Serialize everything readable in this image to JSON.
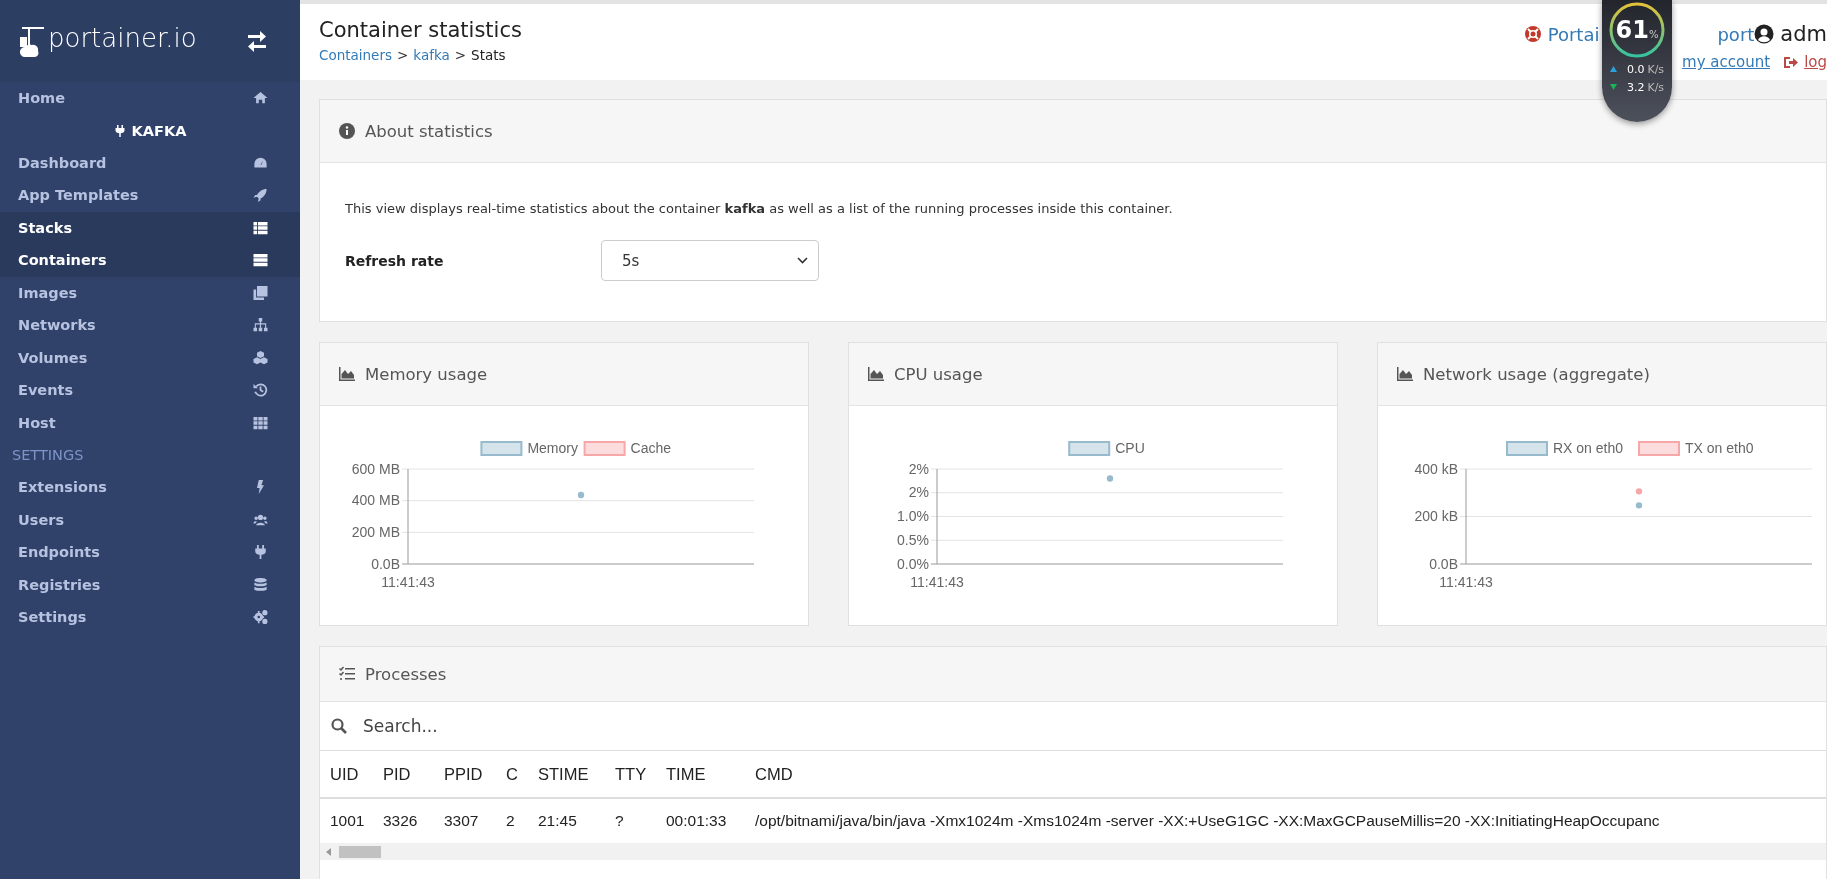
{
  "sidebar": {
    "logo": "portainer.io",
    "items": [
      {
        "kind": "link",
        "label": "Home",
        "selected": false
      },
      {
        "kind": "endpoint",
        "label": "KAFKA"
      },
      {
        "kind": "link",
        "label": "Dashboard",
        "selected": false
      },
      {
        "kind": "link",
        "label": "App Templates",
        "selected": false
      },
      {
        "kind": "link",
        "label": "Stacks",
        "selected": true
      },
      {
        "kind": "link",
        "label": "Containers",
        "selected": true
      },
      {
        "kind": "link",
        "label": "Images",
        "selected": false
      },
      {
        "kind": "link",
        "label": "Networks",
        "selected": false
      },
      {
        "kind": "link",
        "label": "Volumes",
        "selected": false
      },
      {
        "kind": "link",
        "label": "Events",
        "selected": false
      },
      {
        "kind": "link",
        "label": "Host",
        "selected": false
      },
      {
        "kind": "section",
        "label": "SETTINGS"
      },
      {
        "kind": "link",
        "label": "Extensions",
        "selected": false
      },
      {
        "kind": "link",
        "label": "Users",
        "selected": false
      },
      {
        "kind": "link",
        "label": "Endpoints",
        "selected": false
      },
      {
        "kind": "link",
        "label": "Registries",
        "selected": false
      },
      {
        "kind": "link",
        "label": "Settings",
        "selected": false
      }
    ]
  },
  "header": {
    "title": "Container statistics",
    "breadcrumb": [
      {
        "kind": "link",
        "label": "Containers"
      },
      {
        "kind": "separator",
        "label": ">"
      },
      {
        "kind": "link",
        "label": "kafka"
      },
      {
        "kind": "separator",
        "label": ">"
      },
      {
        "kind": "current",
        "label": "Stats"
      }
    ],
    "support_link": [
      "Portai",
      "port"
    ],
    "user": "adm",
    "account_link": "my account",
    "logout_link": "log"
  },
  "monitor_widget": {
    "value": "61",
    "unit": "%",
    "upload": "0.0",
    "upload_unit": "K/s",
    "download": "3.2",
    "download_unit": "K/s"
  },
  "about": {
    "title": "About statistics",
    "text": "This view displays real-time statistics about the container **kafka** as well as a list of the running processes inside this container.",
    "refresh_label": "Refresh rate",
    "refresh_value": "5s"
  },
  "charts": [
    {
      "title": "Memory usage",
      "chart_data": {
        "type": "line",
        "grid": true,
        "legend": "top",
        "annotations": [
          {
            "text": "11:41:43"
          }
        ],
        "ylim": [
          0,
          600
        ],
        "yticks": [
          {
            "value": 0,
            "label": "0.0B"
          },
          {
            "value": 200,
            "label": "200 MB"
          },
          {
            "value": 400,
            "label": "400 MB"
          },
          {
            "value": 600,
            "label": "600 MB"
          }
        ],
        "series": [
          {
            "name": "Memory",
            "color": "#97bbcd",
            "marker": "circle",
            "values": [
              436
            ]
          },
          {
            "name": "Cache",
            "color": "#f7a7a7",
            "values": [
              null
            ]
          }
        ]
      }
    },
    {
      "title": "CPU usage",
      "chart_data": {
        "type": "line",
        "grid": true,
        "legend": "top",
        "annotations": [
          {
            "text": "11:41:43"
          }
        ],
        "ylim": [
          0,
          2
        ],
        "yticks": [
          {
            "value": 0,
            "label": "0.0%"
          },
          {
            "value": 0.5,
            "label": "0.5%"
          },
          {
            "value": 1,
            "label": "1.0%"
          },
          {
            "value": 1.5,
            "label": "2%"
          },
          {
            "value": 2,
            "label": "2%"
          }
        ],
        "series": [
          {
            "name": "CPU",
            "color": "#97bbcd",
            "marker": "circle",
            "values": [
              1.8
            ]
          }
        ]
      }
    },
    {
      "title": "Network usage (aggregate)",
      "chart_data": {
        "type": "line",
        "grid": true,
        "legend": "top",
        "annotations": [
          {
            "text": "11:41:43"
          }
        ],
        "ylim": [
          0,
          400
        ],
        "yticks": [
          {
            "value": 0,
            "label": "0.0B"
          },
          {
            "value": 200,
            "label": "200 kB"
          },
          {
            "value": 400,
            "label": "400 kB"
          }
        ],
        "series": [
          {
            "name": "RX on eth0",
            "color": "#97bbcd",
            "marker": "circle",
            "values": [
              247
            ]
          },
          {
            "name": "TX on eth0",
            "color": "#f7a7a7",
            "marker": "circle",
            "values": [
              306
            ]
          }
        ]
      }
    }
  ],
  "processes": {
    "title": "Processes",
    "search_placeholder": "Search...",
    "columns": [
      "UID",
      "PID",
      "PPID",
      "C",
      "STIME",
      "TTY",
      "TIME",
      "CMD"
    ],
    "rows": [
      [
        "1001",
        "3326",
        "3307",
        "2",
        "21:45",
        "?",
        "00:01:33",
        "/opt/bitnami/java/bin/java -Xmx1024m -Xms1024m -server -XX:+UseG1GC -XX:MaxGCPauseMillis=20 -XX:InitiatingHeapOccupanc"
      ]
    ]
  }
}
